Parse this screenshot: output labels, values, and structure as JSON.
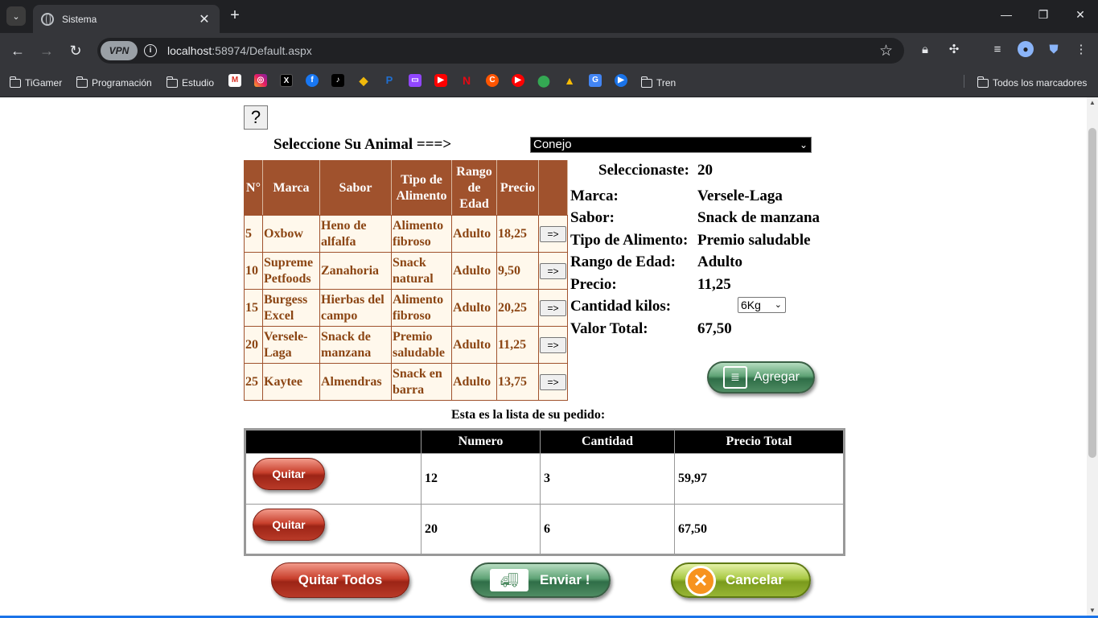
{
  "browser": {
    "tab_title": "Sistema",
    "url_host": "localhost",
    "url_rest": ":58974/Default.aspx",
    "vpn_label": "VPN",
    "bookmarks": [
      "TiGamer",
      "Programación",
      "Estudio",
      "Tren"
    ],
    "all_bookmarks": "Todos los marcadores"
  },
  "page": {
    "help_label": "?",
    "select_label": "Seleccione Su Animal ===>",
    "animal_selected": "Conejo",
    "table_headers": [
      "N°",
      "Marca",
      "Sabor",
      "Tipo de Alimento",
      "Rango de Edad",
      "Precio",
      ""
    ],
    "products": [
      {
        "num": "5",
        "marca": "Oxbow",
        "sabor": "Heno de alfalfa",
        "tipo": "Alimento fibroso",
        "rango": "Adulto",
        "precio": "18,25",
        "btn": "=>"
      },
      {
        "num": "10",
        "marca": "Supreme Petfoods",
        "sabor": "Zanahoria",
        "tipo": "Snack natural",
        "rango": "Adulto",
        "precio": "9,50",
        "btn": "=>"
      },
      {
        "num": "15",
        "marca": "Burgess Excel",
        "sabor": "Hierbas del campo",
        "tipo": "Alimento fibroso",
        "rango": "Adulto",
        "precio": "20,25",
        "btn": "=>"
      },
      {
        "num": "20",
        "marca": "Versele-Laga",
        "sabor": "Snack de manzana",
        "tipo": "Premio saludable",
        "rango": "Adulto",
        "precio": "11,25",
        "btn": "=>"
      },
      {
        "num": "25",
        "marca": "Kaytee",
        "sabor": "Almendras",
        "tipo": "Snack en barra",
        "rango": "Adulto",
        "precio": "13,75",
        "btn": "=>"
      }
    ],
    "detail": {
      "seleccionaste_label": "Seleccionaste:",
      "seleccionaste_value": "20",
      "marca_label": "Marca:",
      "marca_value": "Versele-Laga",
      "sabor_label": "Sabor:",
      "sabor_value": "Snack de manzana",
      "tipo_label": "Tipo de Alimento:",
      "tipo_value": "Premio saludable",
      "rango_label": "Rango de Edad:",
      "rango_value": "Adulto",
      "precio_label": "Precio:",
      "precio_value": "11,25",
      "cantidad_label": "Cantidad kilos:",
      "cantidad_value": "6Kg",
      "total_label": "Valor Total:",
      "total_value": "67,50"
    },
    "agregar_label": "Agregar",
    "list_caption": "Esta es la lista de su pedido:",
    "order_headers": [
      "",
      "Numero",
      "Cantidad",
      "Precio Total"
    ],
    "orders": [
      {
        "action": "Quitar",
        "numero": "12",
        "cantidad": "3",
        "precio_total": "59,97"
      },
      {
        "action": "Quitar",
        "numero": "20",
        "cantidad": "6",
        "precio_total": "67,50"
      }
    ],
    "quitar_todos_label": "Quitar Todos",
    "enviar_label": "Enviar !",
    "cancelar_label": "Cancelar"
  }
}
